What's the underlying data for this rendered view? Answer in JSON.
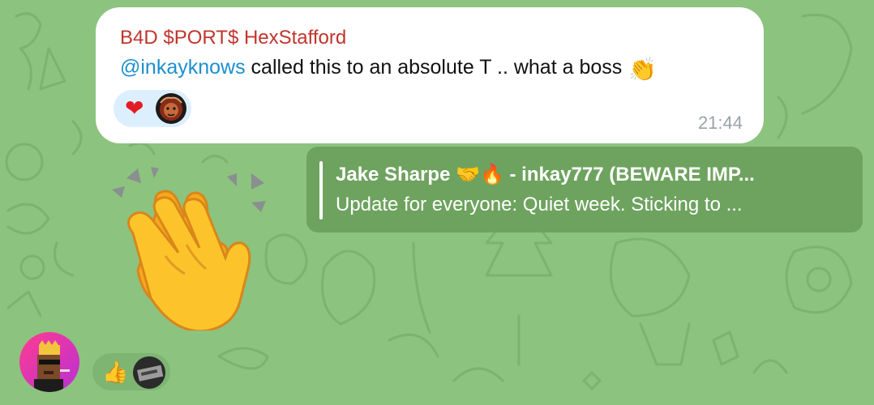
{
  "message": {
    "sender": "B4D $PORT$ HexStafford",
    "mention": "@inkayknows",
    "text": " called this to an absolute T .. what a boss",
    "emoji": "👏",
    "reactions": [
      {
        "emoji": "❤",
        "icon": "heart-icon"
      },
      {
        "icon": "lion-avatar"
      }
    ],
    "time": "21:44"
  },
  "reply": {
    "author": "Jake Sharpe 🤝🔥 - inkay777 (BEWARE IMP...",
    "preview": "Update for everyone:  Quiet week.  Sticking to ..."
  },
  "sticker": {
    "icon": "clapping-hands-sticker"
  },
  "bottom_reactions": [
    {
      "emoji": "👍",
      "icon": "thumbs-up-icon"
    },
    {
      "icon": "user-avatar"
    }
  ],
  "colors": {
    "background": "#8cc37e",
    "sender": "#c0352c",
    "mention": "#1b8fd0",
    "reply_bg": "#6ea35f",
    "reaction_bg": "#dcefff"
  }
}
